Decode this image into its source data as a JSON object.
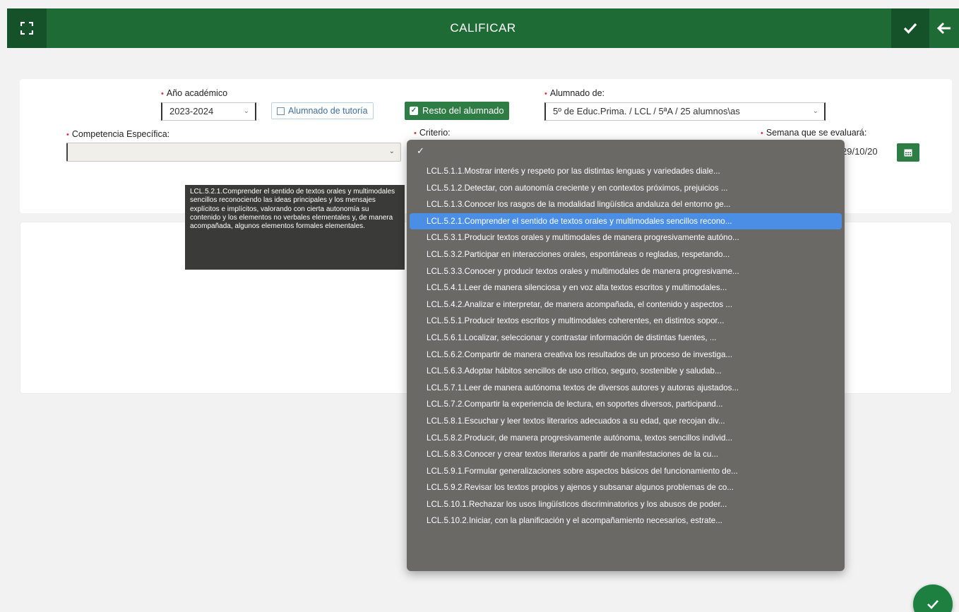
{
  "header": {
    "title": "CALIFICAR",
    "expand_icon": "fullscreen-icon",
    "confirm_icon": "check-icon",
    "back_icon": "arrow-left-icon"
  },
  "filters": {
    "anio_label": "Año académico",
    "anio_value": "2023-2024",
    "tutoria_label": "Alumnado de tutoría",
    "resto_label": "Resto del alumnado",
    "alumnado_label": "Alumnado de:",
    "alumnado_value": "5º de Educ.Prima. / LCL / 5ªA / 25 alumnos\\as",
    "competencia_label": "Competencia Específica:",
    "competencia_value": "",
    "criterio_label": "Criterio:",
    "semana_label": "Semana que se evaluará:",
    "semana_value": "29/10/20"
  },
  "tooltip": {
    "text": "LCL.5.2.1.Comprender el sentido de textos orales y multimodales sencillos reconociendo las ideas principales y los mensajes explícitos e implícitos, valorando con cierta autonomía su contenido y los elementos no verbales elementales y, de manera acompañada, algunos elementos formales elementales."
  },
  "criterio_dropdown": {
    "empty_option": "✓",
    "selected_index": 3,
    "options": [
      "LCL.5.1.1.Mostrar interés y respeto por las distintas lenguas y variedades diale...",
      "LCL.5.1.2.Detectar, con autonomía creciente y en contextos próximos, prejuicios ...",
      "LCL.5.1.3.Conocer los rasgos de la modalidad lingüística andaluza del entorno ge...",
      "LCL.5.2.1.Comprender el sentido de textos orales y multimodales sencillos recono...",
      "LCL.5.3.1.Producir textos orales y multimodales de manera progresivamente autóno...",
      "LCL.5.3.2.Participar en interacciones orales, espontáneas o regladas, respetando...",
      "LCL.5.3.3.Conocer y producir textos orales y multimodales de manera progresivame...",
      "LCL.5.4.1.Leer de manera silenciosa y en voz alta textos escritos y multimodales...",
      "LCL.5.4.2.Analizar e interpretar, de manera acompañada, el contenido y aspectos ...",
      "LCL.5.5.1.Producir textos escritos y multimodales coherentes, en distintos sopor...",
      "LCL.5.6.1.Localizar, seleccionar y contrastar información de distintas fuentes, ...",
      "LCL.5.6.2.Compartir de manera creativa los resultados de un proceso de investiga...",
      "LCL.5.6.3.Adoptar hábitos sencillos de uso crítico, seguro, sostenible y saludab...",
      "LCL.5.7.1.Leer de manera autónoma textos de diversos autores y autoras ajustados...",
      "LCL.5.7.2.Compartir la experiencia de lectura, en soportes diversos, participand...",
      "LCL.5.8.1.Escuchar y leer textos literarios adecuados a su edad, que recojan div...",
      "LCL.5.8.2.Producir, de manera progresivamente autónoma, textos sencillos individ...",
      "LCL.5.8.3.Conocer y crear textos literarios a partir de manifestaciones de la cu...",
      "LCL.5.9.1.Formular generalizaciones sobre aspectos básicos del funcionamiento de...",
      "LCL.5.9.2.Revisar los textos propios y ajenos y subsanar algunos problemas de co...",
      "LCL.5.10.1.Rechazar los usos lingüísticos discriminatorios y los abusos de poder...",
      "LCL.5.10.2.Iniciar, con la planificación y el acompañamiento necesarios, estrate..."
    ]
  },
  "fab": {
    "icon": "check-icon"
  },
  "colors": {
    "primary": "#1e6b35",
    "accent": "#2e7d45",
    "highlight": "#4b8ee6",
    "required": "#e0323a"
  }
}
